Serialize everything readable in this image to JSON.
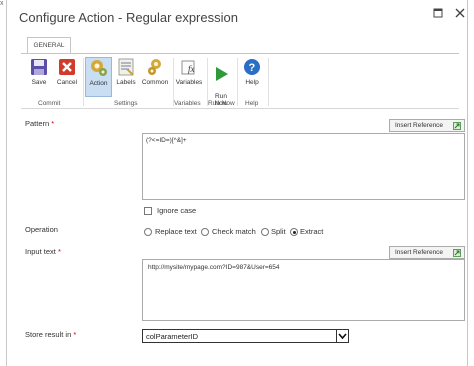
{
  "window": {
    "title": "Configure Action - Regular expression",
    "outer_glyph": "x"
  },
  "ribbon": {
    "tab": "GENERAL",
    "buttons": [
      {
        "label": "Save",
        "icon": "save-icon"
      },
      {
        "label": "Cancel",
        "icon": "cancel-icon"
      },
      {
        "label": "Action",
        "icon": "action-icon",
        "active": true
      },
      {
        "label": "Labels",
        "icon": "labels-icon"
      },
      {
        "label": "Common",
        "icon": "common-icon"
      },
      {
        "label": "Variables",
        "icon": "variables-icon"
      },
      {
        "label": "Run\nNow",
        "icon": "run-icon"
      },
      {
        "label": "Help",
        "icon": "help-icon"
      }
    ],
    "groups": [
      "Commit",
      "Settings",
      "Variables",
      "Run Now",
      "Help"
    ]
  },
  "pattern": {
    "label": "Pattern",
    "required": "*",
    "value": "(?<=ID=)[^&]+",
    "insert_reference": "Insert Reference"
  },
  "ignore_case": {
    "label": "Ignore case",
    "checked": false
  },
  "operation": {
    "label": "Operation",
    "options": [
      "Replace text",
      "Check match",
      "Split",
      "Extract"
    ],
    "selected": "Extract"
  },
  "input_text": {
    "label": "Input text",
    "required": "*",
    "value": "http://mysite/mypage.com?ID=987&User=654",
    "insert_reference": "Insert Reference"
  },
  "store_result": {
    "label": "Store result in",
    "required": "*",
    "value": "colParameterID"
  }
}
